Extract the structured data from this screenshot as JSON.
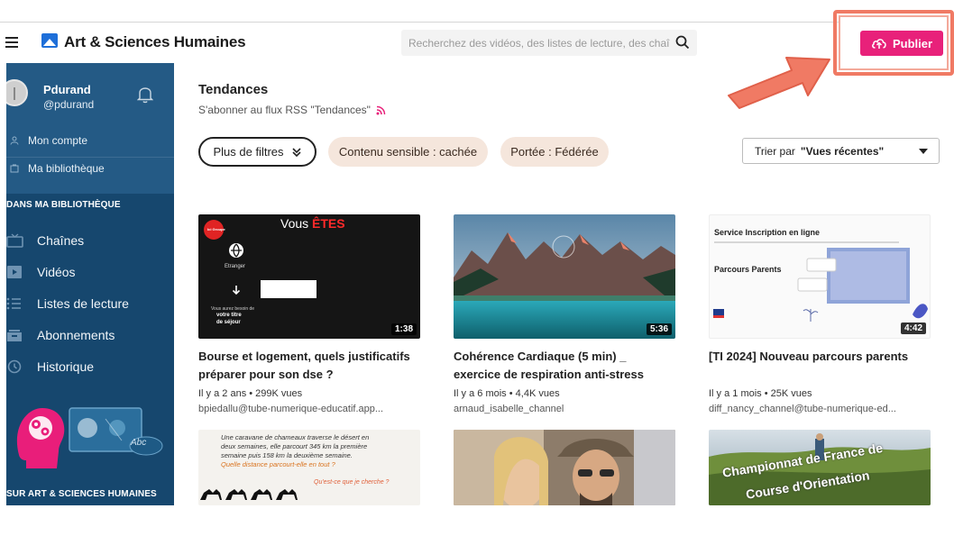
{
  "header": {
    "brand": "Art & Sciences Humaines",
    "search_placeholder": "Recherchez des vidéos, des listes de lecture, des chaîne",
    "publish_label": "Publier"
  },
  "user": {
    "name": "Pdurand",
    "handle": "@pdurand",
    "links": [
      {
        "label": "Mon compte",
        "icon": "user-icon"
      },
      {
        "label": "Ma bibliothèque",
        "icon": "library-icon"
      }
    ]
  },
  "sidebar": {
    "section_library": "DANS MA BIBLIOTHÈQUE",
    "items": [
      {
        "label": "Chaînes",
        "icon": "tv-icon"
      },
      {
        "label": "Vidéos",
        "icon": "video-icon"
      },
      {
        "label": "Listes de lecture",
        "icon": "list-icon"
      },
      {
        "label": "Abonnements",
        "icon": "inbox-icon"
      },
      {
        "label": "Historique",
        "icon": "history-icon"
      }
    ],
    "section_about": "SUR ART & SCIENCES HUMAINES",
    "illustration_label": "Abc"
  },
  "main": {
    "title": "Tendances",
    "rss_label": "S'abonner au flux RSS \"Tendances\"",
    "filters_label": "Plus de filtres",
    "chips": [
      "Contenu sensible : cachée",
      "Portée : Fédérée"
    ],
    "sort_prefix": "Trier par",
    "sort_value": "\"Vues récentes\""
  },
  "videos": [
    {
      "title": "Bourse et logement, quels justificatifs préparer pour son dse ?",
      "meta": "Il y a 2 ans • 299K vues",
      "channel": "bpiedallu@tube-numerique-educatif.app...",
      "duration": "1:38",
      "thumb_text": {
        "headline_a": "Vous ",
        "headline_b": "ÊTES",
        "etranger": "Etranger",
        "note_a": "Vous aurez besoin de",
        "note_b": "votre titre",
        "note_c": "de séjour",
        "badge": "Ici Groupe"
      }
    },
    {
      "title": "Cohérence Cardiaque (5 min) _ exercice de respiration anti-stress",
      "meta": "Il y a 6 mois • 4,4K vues",
      "channel": "arnaud_isabelle_channel",
      "duration": "5:36"
    },
    {
      "title": "[TI 2024] Nouveau parcours parents",
      "meta": "Il y a 1 mois • 25K vues",
      "channel": "diff_nancy_channel@tube-numerique-ed...",
      "duration": "4:42",
      "thumb_text": {
        "line1": "Service Inscription en ligne",
        "line2": "Parcours Parents"
      }
    }
  ],
  "videos_row2": [
    {
      "thumb_text": {
        "l1": "Une caravane de chameaux traverse le désert en",
        "l2": "deux semaines, elle parcourt 345 km la première",
        "l3": "semaine puis 158 km la deuxième semaine.",
        "l4": "Quelle distance parcourt-elle en tout ?",
        "l5": "Qu'est-ce que je cherche ?"
      }
    },
    {},
    {
      "thumb_text": {
        "l1": "Championnat de France de",
        "l2": "Course d'Orientation"
      }
    }
  ],
  "colors": {
    "accent": "#e8217a",
    "sidebar": "#16476e",
    "annotation": "#f07a64"
  }
}
